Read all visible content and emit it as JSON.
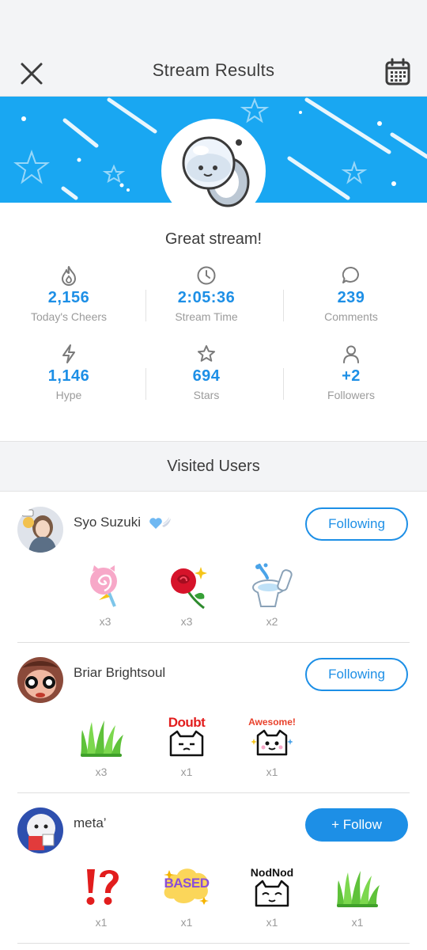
{
  "header": {
    "title": "Stream Results"
  },
  "summary": {
    "message": "Great stream!"
  },
  "stats": [
    {
      "value": "2,156",
      "label": "Today's Cheers",
      "icon": "fire-icon"
    },
    {
      "value": "2:05:36",
      "label": "Stream Time",
      "icon": "clock-icon"
    },
    {
      "value": "239",
      "label": "Comments",
      "icon": "comment-icon"
    },
    {
      "value": "1,146",
      "label": "Hype",
      "icon": "lightning-icon"
    },
    {
      "value": "694",
      "label": "Stars",
      "icon": "star-icon"
    },
    {
      "value": "+2",
      "label": "Followers",
      "icon": "person-icon"
    }
  ],
  "section": {
    "title": "Visited Users"
  },
  "users": [
    {
      "name": "Syo Suzuki",
      "button": "Following",
      "gifts": [
        {
          "icon": "lollipop-icon",
          "count": "x3"
        },
        {
          "icon": "rose-icon",
          "count": "x3"
        },
        {
          "icon": "toilet-icon",
          "count": "x2"
        }
      ]
    },
    {
      "name": "Briar Brightsoul",
      "button": "Following",
      "gifts": [
        {
          "icon": "grass-icon",
          "count": "x3"
        },
        {
          "icon": "doubt-cat-sticker-icon",
          "text": "Doubt",
          "count": "x1"
        },
        {
          "icon": "awesome-cat-sticker-icon",
          "text": "Awesome!",
          "count": "x1"
        }
      ]
    },
    {
      "name": "meta’",
      "button": "+ Follow",
      "gifts": [
        {
          "icon": "interrobang-icon",
          "count": "x1"
        },
        {
          "icon": "based-sticker-icon",
          "text": "BASED",
          "count": "x1"
        },
        {
          "icon": "nodnod-cat-sticker-icon",
          "text": "NodNod",
          "count": "x1"
        },
        {
          "icon": "grass-icon",
          "count": "x1"
        }
      ]
    }
  ],
  "colors": {
    "accent": "#1d8fe6",
    "banner": "#19a7f2",
    "header_bg": "#f3f4f6"
  }
}
